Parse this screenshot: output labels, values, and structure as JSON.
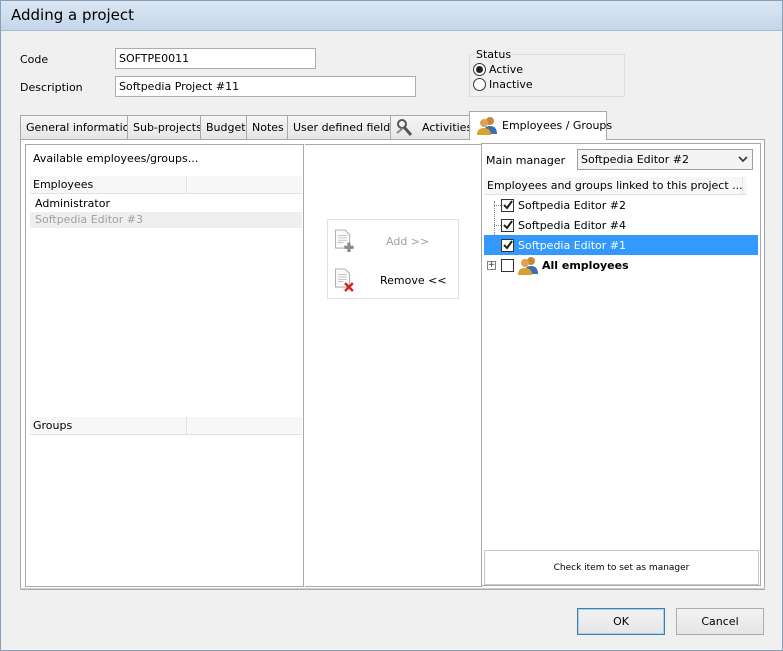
{
  "window": {
    "title": "Adding a project"
  },
  "form": {
    "code_label": "Code",
    "code_value": "SOFTPE0011",
    "description_label": "Description",
    "description_value": "Softpedia Project #11",
    "status": {
      "label": "Status",
      "options": [
        "Active",
        "Inactive"
      ],
      "selected": "Active"
    }
  },
  "tabs": [
    {
      "label": "General information"
    },
    {
      "label": "Sub-projects"
    },
    {
      "label": "Budget"
    },
    {
      "label": "Notes"
    },
    {
      "label": "User defined fields"
    },
    {
      "label": "Activities",
      "icon": "activities-icon"
    },
    {
      "label": "Employees / Groups",
      "icon": "people-icon",
      "active": true
    }
  ],
  "available": {
    "title": "Available employees/groups...",
    "employees_header": "Employees",
    "employees": [
      "Administrator",
      "Softpedia Editor #3"
    ],
    "groups_header": "Groups",
    "groups": []
  },
  "actions": {
    "add_label": "Add   >>",
    "remove_label": "Remove <<"
  },
  "linked": {
    "main_manager_label": "Main manager",
    "main_manager_value": "Softpedia Editor #2",
    "header": "Employees and groups linked to this project ...",
    "items": [
      {
        "label": "Softpedia Editor #2",
        "checked": true
      },
      {
        "label": "Softpedia Editor #4",
        "checked": true
      },
      {
        "label": "Softpedia Editor #1",
        "checked": true,
        "selected": true
      },
      {
        "label": "All employees",
        "checked": false,
        "bold": true,
        "expandable": true
      }
    ],
    "hint": "Check item to set as manager"
  },
  "buttons": {
    "ok": "OK",
    "cancel": "Cancel"
  },
  "colors": {
    "selection": "#3399ff",
    "disabled_text": "#a0a0a0",
    "titlebar": "#c5d6ea"
  }
}
